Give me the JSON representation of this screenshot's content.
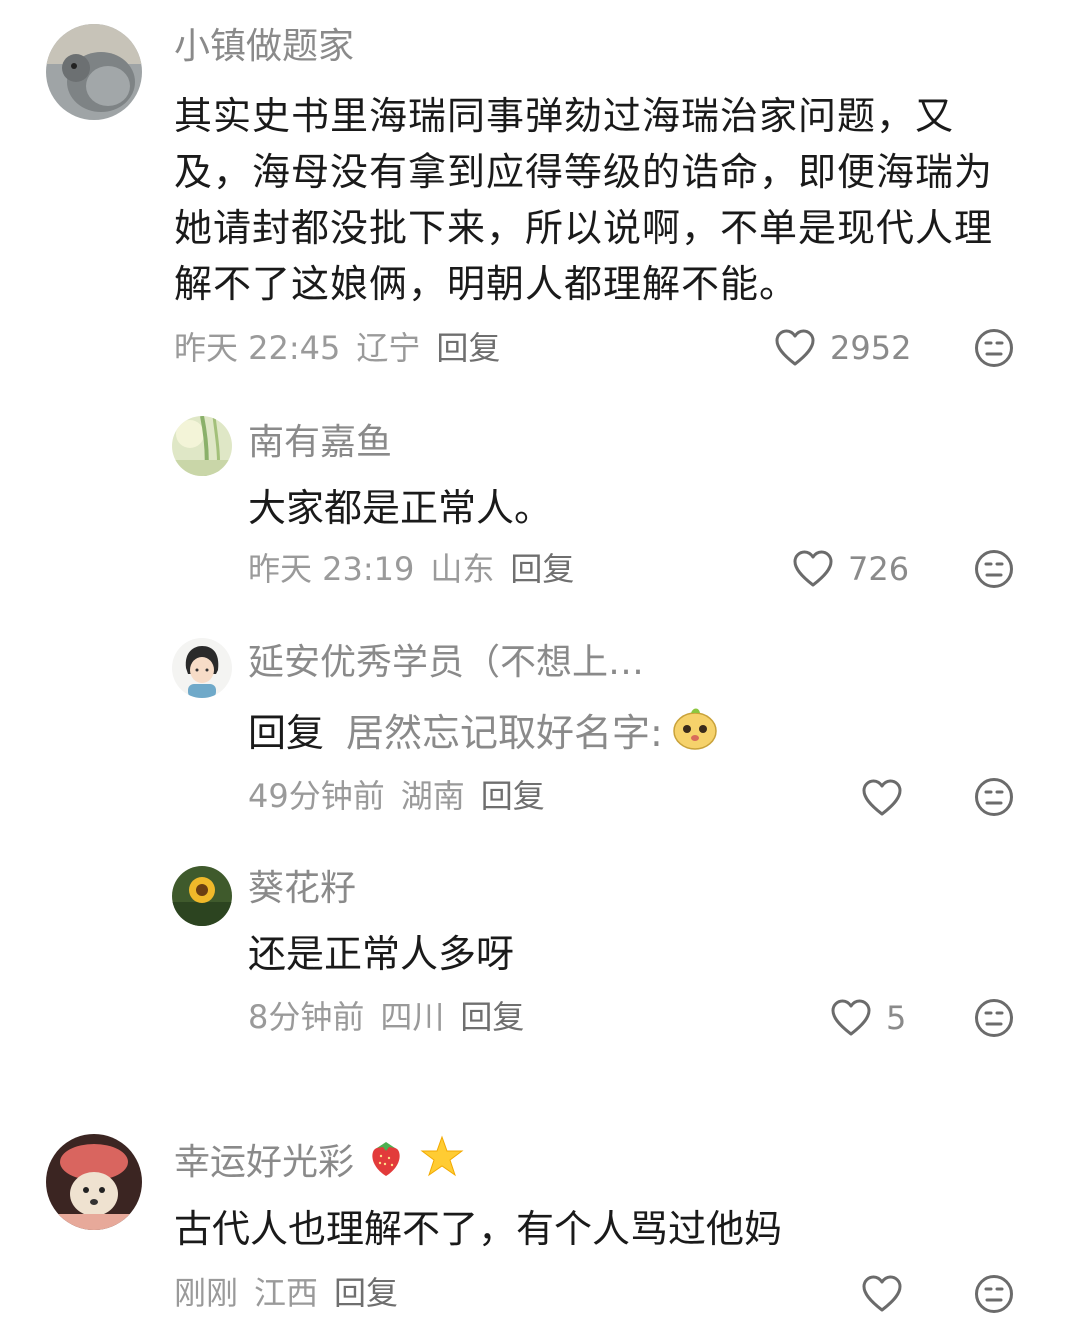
{
  "comments": [
    {
      "username": "小镇做题家",
      "text": "其实史书里海瑞同事弹劾过海瑞治家问题，又及，海母没有拿到应得等级的诰命，即便海瑞为她请封都没批下来，所以说啊，不单是现代人理解不了这娘俩，明朝人都理解不能。",
      "time": "昨天 22:45",
      "location": "辽宁",
      "reply_label": "回复",
      "likes": "2952",
      "replies": [
        {
          "username": "南有嘉鱼",
          "text": "大家都是正常人。",
          "time": "昨天 23:19",
          "location": "山东",
          "reply_label": "回复",
          "likes": "726"
        },
        {
          "username": "延安优秀学员（不想上…",
          "reply_prefix": "回复",
          "reply_target": "居然忘记取好名字:",
          "time": "49分钟前",
          "location": "湖南",
          "reply_label": "回复",
          "likes": ""
        },
        {
          "username": "葵花籽",
          "text": "还是正常人多呀",
          "time": "8分钟前",
          "location": "四川",
          "reply_label": "回复",
          "likes": "5"
        }
      ]
    },
    {
      "username": "幸运好光彩",
      "username_emojis": [
        "strawberry-emoji",
        "star-emoji"
      ],
      "text": "古代人也理解不了，有个人骂过他妈",
      "time": "刚刚",
      "location": "江西",
      "reply_label": "回复",
      "likes": ""
    }
  ],
  "icons": {
    "like": "heart-outline-icon",
    "dislike": "meh-face-icon"
  },
  "colors": {
    "text_primary": "#1a1a1a",
    "text_secondary": "#8a8a8a",
    "icon": "#6b6b6b",
    "background": "#ffffff"
  }
}
